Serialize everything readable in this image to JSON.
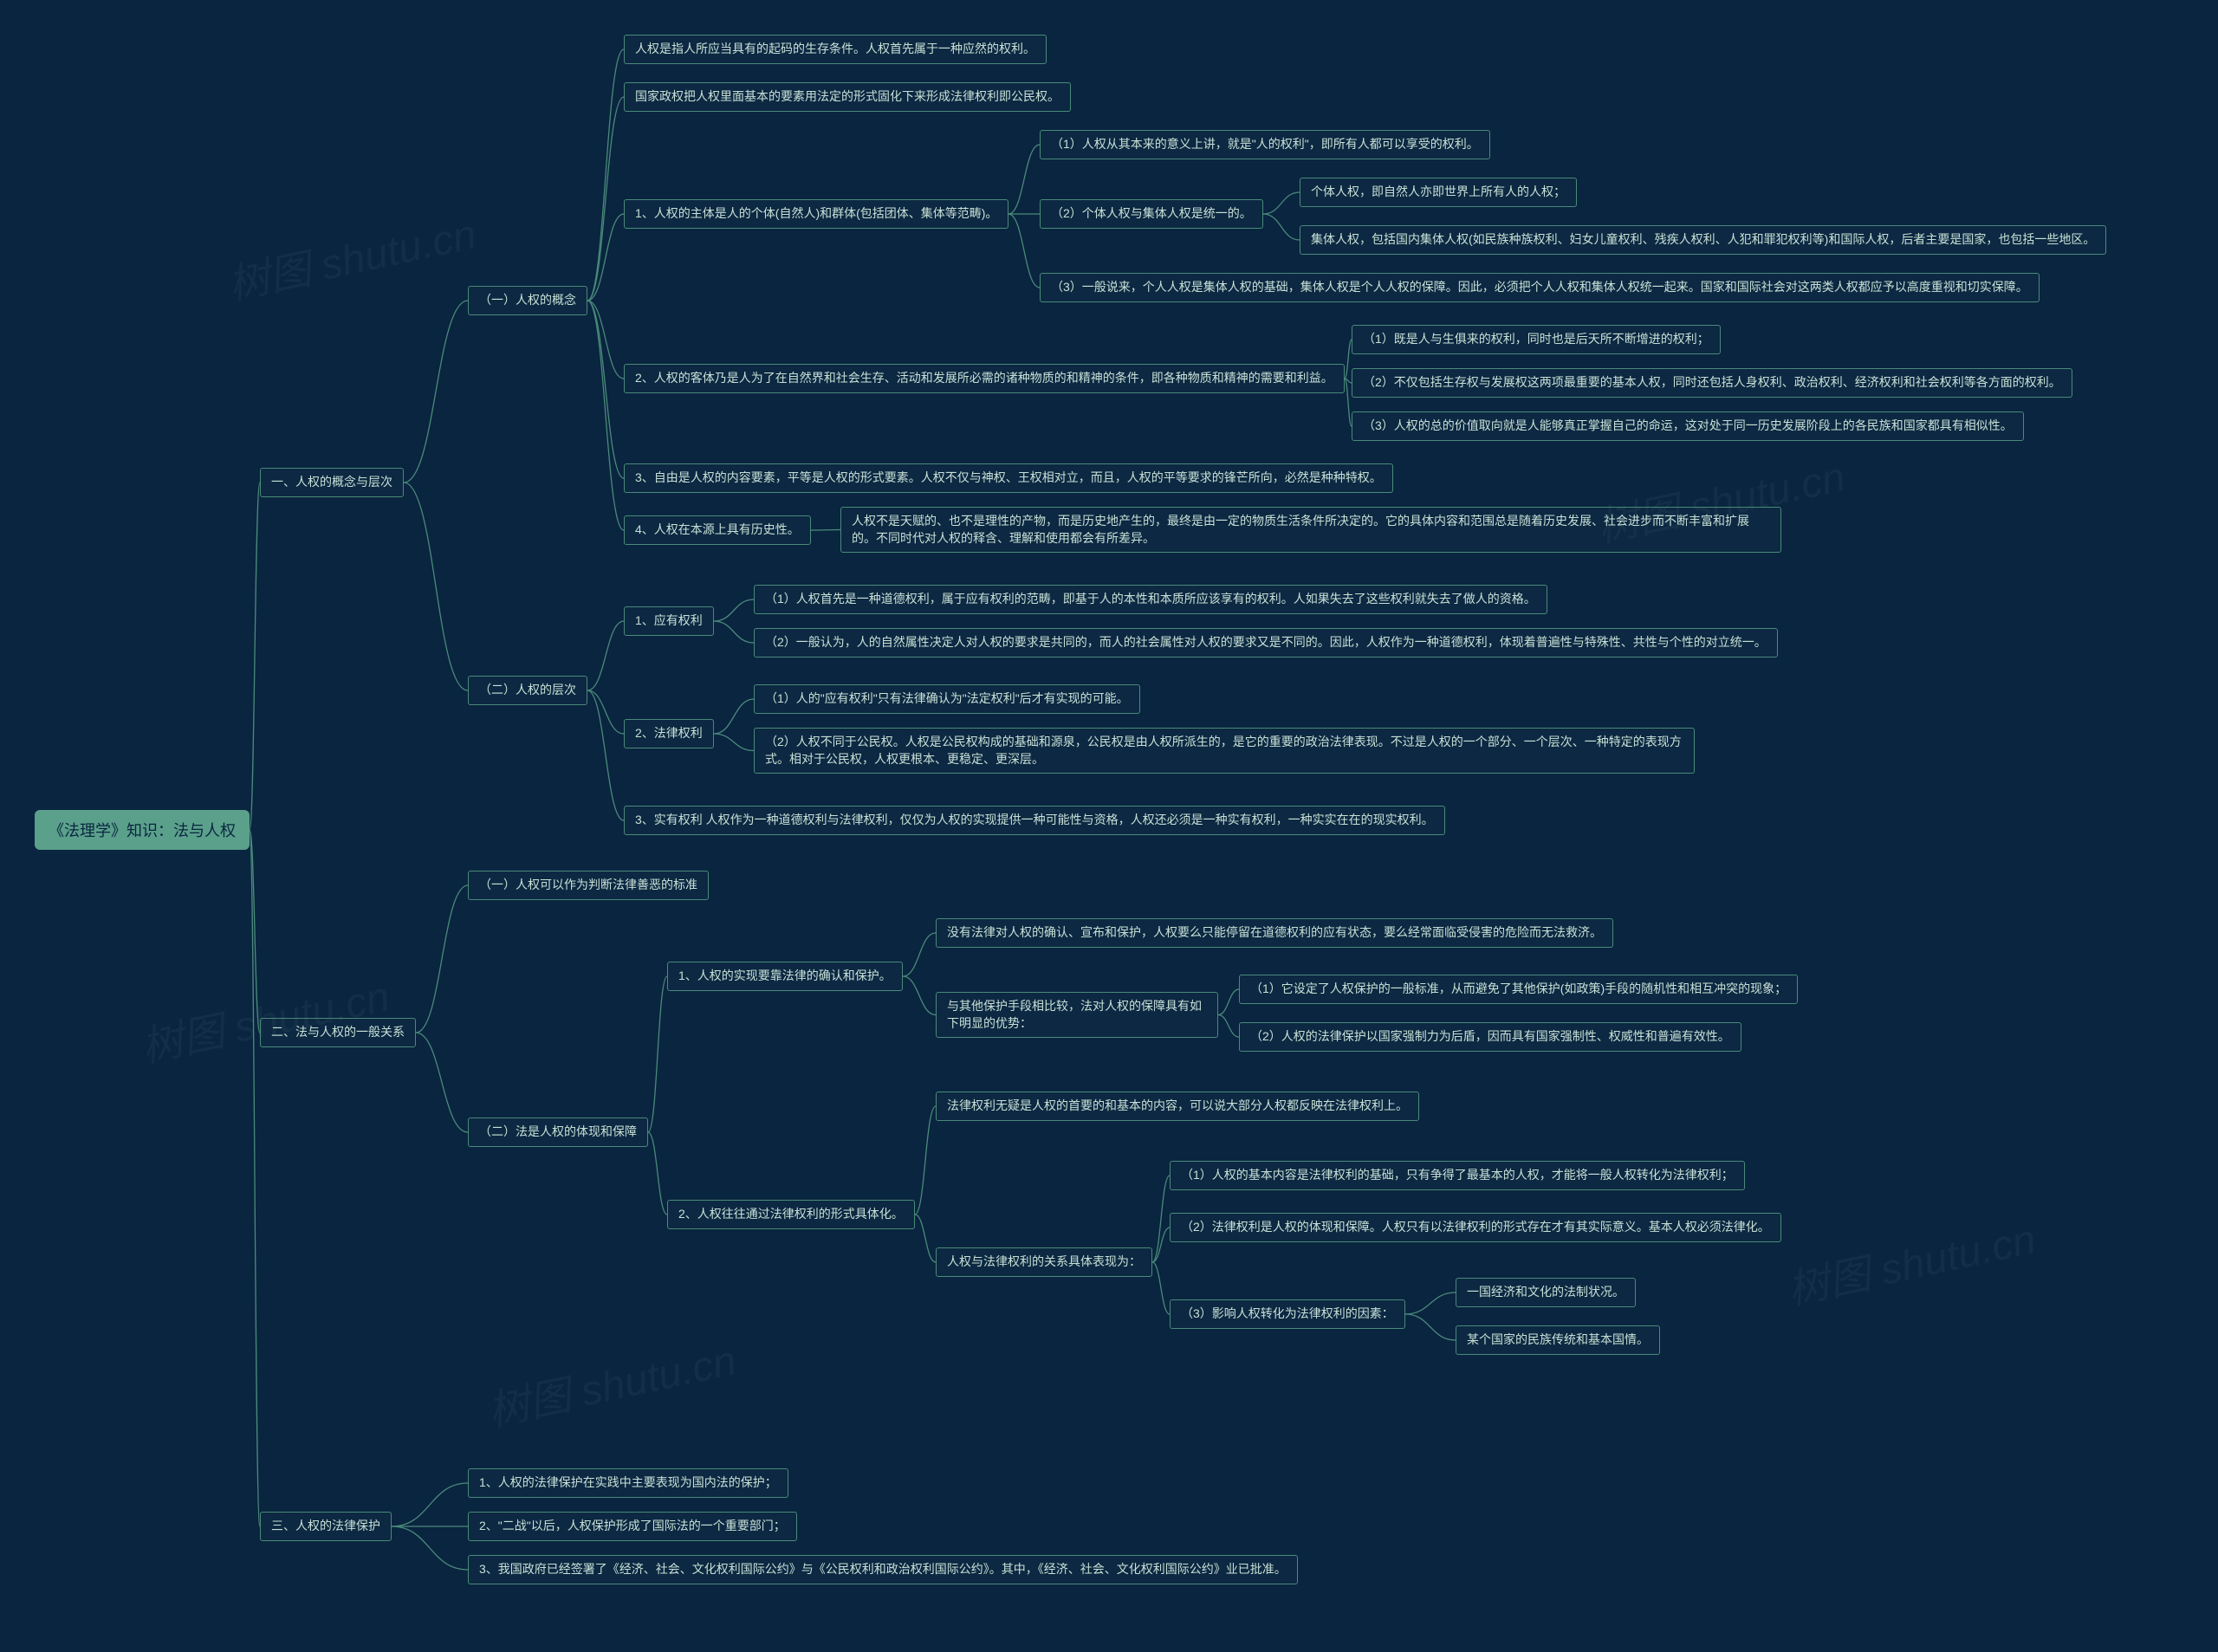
{
  "root": "《法理学》知识：法与人权",
  "s1": {
    "title": "一、人权的概念与层次",
    "a": {
      "title": "（一）人权的概念",
      "i1": "人权是指人所应当具有的起码的生存条件。人权首先属于一种应然的权利。",
      "i2": "国家政权把人权里面基本的要素用法定的形式固化下来形成法律权利即公民权。",
      "i3": {
        "title": "1、人权的主体是人的个体(自然人)和群体(包括团体、集体等范畴)。",
        "c1": "（1）人权从其本来的意义上讲，就是\"人的权利\"，即所有人都可以享受的权利。",
        "c2": {
          "title": "（2）个体人权与集体人权是统一的。",
          "d1": "个体人权，即自然人亦即世界上所有人的人权；",
          "d2": "集体人权，包括国内集体人权(如民族种族权利、妇女儿童权利、残疾人权利、人犯和罪犯权利等)和国际人权，后者主要是国家，也包括一些地区。"
        },
        "c3": "（3）一般说来，个人人权是集体人权的基础，集体人权是个人人权的保障。因此，必须把个人人权和集体人权统一起来。国家和国际社会对这两类人权都应予以高度重视和切实保障。"
      },
      "i4": {
        "title": "2、人权的客体乃是人为了在自然界和社会生存、活动和发展所必需的诸种物质的和精神的条件，即各种物质和精神的需要和利益。",
        "c1": "（1）既是人与生俱来的权利，同时也是后天所不断增进的权利；",
        "c2": "（2）不仅包括生存权与发展权这两项最重要的基本人权，同时还包括人身权利、政治权利、经济权利和社会权利等各方面的权利。",
        "c3": "（3）人权的总的价值取向就是人能够真正掌握自己的命运，这对处于同一历史发展阶段上的各民族和国家都具有相似性。"
      },
      "i5": "3、自由是人权的内容要素，平等是人权的形式要素。人权不仅与神权、王权相对立，而且，人权的平等要求的锋芒所向，必然是种种特权。",
      "i6": {
        "title": "4、人权在本源上具有历史性。",
        "text": "人权不是天赋的、也不是理性的产物，而是历史地产生的，最终是由一定的物质生活条件所决定的。它的具体内容和范围总是随着历史发展、社会进步而不断丰富和扩展的。不同时代对人权的释含、理解和使用都会有所差异。"
      }
    },
    "b": {
      "title": "（二）人权的层次",
      "i1": {
        "title": "1、应有权利",
        "c1": "（1）人权首先是一种道德权利，属于应有权利的范畴，即基于人的本性和本质所应该享有的权利。人如果失去了这些权利就失去了做人的资格。",
        "c2": "（2）一般认为，人的自然属性决定人对人权的要求是共同的，而人的社会属性对人权的要求又是不同的。因此，人权作为一种道德权利，体现着普遍性与特殊性、共性与个性的对立统一。"
      },
      "i2": {
        "title": "2、法律权利",
        "c1": "（1）人的\"应有权利\"只有法律确认为\"法定权利\"后才有实现的可能。",
        "c2": "（2）人权不同于公民权。人权是公民权构成的基础和源泉，公民权是由人权所派生的，是它的重要的政治法律表现。不过是人权的一个部分、一个层次、一种特定的表现方式。相对于公民权，人权更根本、更稳定、更深层。"
      },
      "i3": "3、实有权利 人权作为一种道德权利与法律权利，仅仅为人权的实现提供一种可能性与资格，人权还必须是一种实有权利，一种实实在在的现实权利。"
    }
  },
  "s2": {
    "title": "二、法与人权的一般关系",
    "a": "（一）人权可以作为判断法律善恶的标准",
    "b": {
      "title": "（二）法是人权的体现和保障",
      "i1": {
        "title": "1、人权的实现要靠法律的确认和保护。",
        "c1": "没有法律对人权的确认、宣布和保护，人权要么只能停留在道德权利的应有状态，要么经常面临受侵害的危险而无法救济。",
        "c2": {
          "title": "与其他保护手段相比较，法对人权的保障具有如下明显的优势：",
          "d1": "（1）它设定了人权保护的一般标准，从而避免了其他保护(如政策)手段的随机性和相互冲突的现象；",
          "d2": "（2）人权的法律保护以国家强制力为后盾，因而具有国家强制性、权威性和普遍有效性。"
        }
      },
      "i2": {
        "title": "2、人权往往通过法律权利的形式具体化。",
        "c1": "法律权利无疑是人权的首要的和基本的内容，可以说大部分人权都反映在法律权利上。",
        "c2": {
          "title": "人权与法律权利的关系具体表现为：",
          "d1": "（1）人权的基本内容是法律权利的基础，只有争得了最基本的人权，才能将一般人权转化为法律权利；",
          "d2": "（2）法律权利是人权的体现和保障。人权只有以法律权利的形式存在才有其实际意义。基本人权必须法律化。",
          "d3": {
            "title": "（3）影响人权转化为法律权利的因素：",
            "e1": "一国经济和文化的法制状况。",
            "e2": "某个国家的民族传统和基本国情。"
          }
        }
      }
    }
  },
  "s3": {
    "title": "三、人权的法律保护",
    "i1": "1、人权的法律保护在实践中主要表现为国内法的保护；",
    "i2": "2、\"二战\"以后，人权保护形成了国际法的一个重要部门；",
    "i3": "3、我国政府已经签署了《经济、社会、文化权利国际公约》与《公民权利和政治权利国际公约》。其中，《经济、社会、文化权利国际公约》业已批准。"
  },
  "chart_data": {
    "type": "mindmap",
    "root": "《法理学》知识：法与人权",
    "children": [
      {
        "label": "一、人权的概念与层次",
        "children": [
          {
            "label": "（一）人权的概念",
            "children": [
              {
                "label": "人权是指人所应当具有的起码的生存条件。人权首先属于一种应然的权利。"
              },
              {
                "label": "国家政权把人权里面基本的要素用法定的形式固化下来形成法律权利即公民权。"
              },
              {
                "label": "1、人权的主体是人的个体(自然人)和群体(包括团体、集体等范畴)。",
                "children": [
                  {
                    "label": "（1）人权从其本来的意义上讲，就是\"人的权利\"，即所有人都可以享受的权利。"
                  },
                  {
                    "label": "（2）个体人权与集体人权是统一的。",
                    "children": [
                      {
                        "label": "个体人权，即自然人亦即世界上所有人的人权；"
                      },
                      {
                        "label": "集体人权，包括国内集体人权(如民族种族权利、妇女儿童权利、残疾人权利、人犯和罪犯权利等)和国际人权，后者主要是国家，也包括一些地区。"
                      }
                    ]
                  },
                  {
                    "label": "（3）一般说来，个人人权是集体人权的基础，集体人权是个人人权的保障。因此，必须把个人人权和集体人权统一起来。国家和国际社会对这两类人权都应予以高度重视和切实保障。"
                  }
                ]
              },
              {
                "label": "2、人权的客体乃是人为了在自然界和社会生存、活动和发展所必需的诸种物质的和精神的条件，即各种物质和精神的需要和利益。",
                "children": [
                  {
                    "label": "（1）既是人与生俱来的权利，同时也是后天所不断增进的权利；"
                  },
                  {
                    "label": "（2）不仅包括生存权与发展权这两项最重要的基本人权，同时还包括人身权利、政治权利、经济权利和社会权利等各方面的权利。"
                  },
                  {
                    "label": "（3）人权的总的价值取向就是人能够真正掌握自己的命运，这对处于同一历史发展阶段上的各民族和国家都具有相似性。"
                  }
                ]
              },
              {
                "label": "3、自由是人权的内容要素，平等是人权的形式要素。人权不仅与神权、王权相对立，而且，人权的平等要求的锋芒所向，必然是种种特权。"
              },
              {
                "label": "4、人权在本源上具有历史性。",
                "children": [
                  {
                    "label": "人权不是天赋的、也不是理性的产物，而是历史地产生的，最终是由一定的物质生活条件所决定的。它的具体内容和范围总是随着历史发展、社会进步而不断丰富和扩展的。不同时代对人权的释含、理解和使用都会有所差异。"
                  }
                ]
              }
            ]
          },
          {
            "label": "（二）人权的层次",
            "children": [
              {
                "label": "1、应有权利",
                "children": [
                  {
                    "label": "（1）人权首先是一种道德权利，属于应有权利的范畴，即基于人的本性和本质所应该享有的权利。人如果失去了这些权利就失去了做人的资格。"
                  },
                  {
                    "label": "（2）一般认为，人的自然属性决定人对人权的要求是共同的，而人的社会属性对人权的要求又是不同的。因此，人权作为一种道德权利，体现着普遍性与特殊性、共性与个性的对立统一。"
                  }
                ]
              },
              {
                "label": "2、法律权利",
                "children": [
                  {
                    "label": "（1）人的\"应有权利\"只有法律确认为\"法定权利\"后才有实现的可能。"
                  },
                  {
                    "label": "（2）人权不同于公民权。人权是公民权构成的基础和源泉，公民权是由人权所派生的，是它的重要的政治法律表现。不过是人权的一个部分、一个层次、一种特定的表现方式。相对于公民权，人权更根本、更稳定、更深层。"
                  }
                ]
              },
              {
                "label": "3、实有权利 人权作为一种道德权利与法律权利，仅仅为人权的实现提供一种可能性与资格，人权还必须是一种实有权利，一种实实在在的现实权利。"
              }
            ]
          }
        ]
      },
      {
        "label": "二、法与人权的一般关系",
        "children": [
          {
            "label": "（一）人权可以作为判断法律善恶的标准"
          },
          {
            "label": "（二）法是人权的体现和保障",
            "children": [
              {
                "label": "1、人权的实现要靠法律的确认和保护。",
                "children": [
                  {
                    "label": "没有法律对人权的确认、宣布和保护，人权要么只能停留在道德权利的应有状态，要么经常面临受侵害的危险而无法救济。"
                  },
                  {
                    "label": "与其他保护手段相比较，法对人权的保障具有如下明显的优势：",
                    "children": [
                      {
                        "label": "（1）它设定了人权保护的一般标准，从而避免了其他保护(如政策)手段的随机性和相互冲突的现象；"
                      },
                      {
                        "label": "（2）人权的法律保护以国家强制力为后盾，因而具有国家强制性、权威性和普遍有效性。"
                      }
                    ]
                  }
                ]
              },
              {
                "label": "2、人权往往通过法律权利的形式具体化。",
                "children": [
                  {
                    "label": "法律权利无疑是人权的首要的和基本的内容，可以说大部分人权都反映在法律权利上。"
                  },
                  {
                    "label": "人权与法律权利的关系具体表现为：",
                    "children": [
                      {
                        "label": "（1）人权的基本内容是法律权利的基础，只有争得了最基本的人权，才能将一般人权转化为法律权利；"
                      },
                      {
                        "label": "（2）法律权利是人权的体现和保障。人权只有以法律权利的形式存在才有其实际意义。基本人权必须法律化。"
                      },
                      {
                        "label": "（3）影响人权转化为法律权利的因素：",
                        "children": [
                          {
                            "label": "一国经济和文化的法制状况。"
                          },
                          {
                            "label": "某个国家的民族传统和基本国情。"
                          }
                        ]
                      }
                    ]
                  }
                ]
              }
            ]
          }
        ]
      },
      {
        "label": "三、人权的法律保护",
        "children": [
          {
            "label": "1、人权的法律保护在实践中主要表现为国内法的保护；"
          },
          {
            "label": "2、\"二战\"以后，人权保护形成了国际法的一个重要部门；"
          },
          {
            "label": "3、我国政府已经签署了《经济、社会、文化权利国际公约》与《公民权利和政治权利国际公约》。其中，《经济、社会、文化权利国际公约》业已批准。"
          }
        ]
      }
    ]
  }
}
